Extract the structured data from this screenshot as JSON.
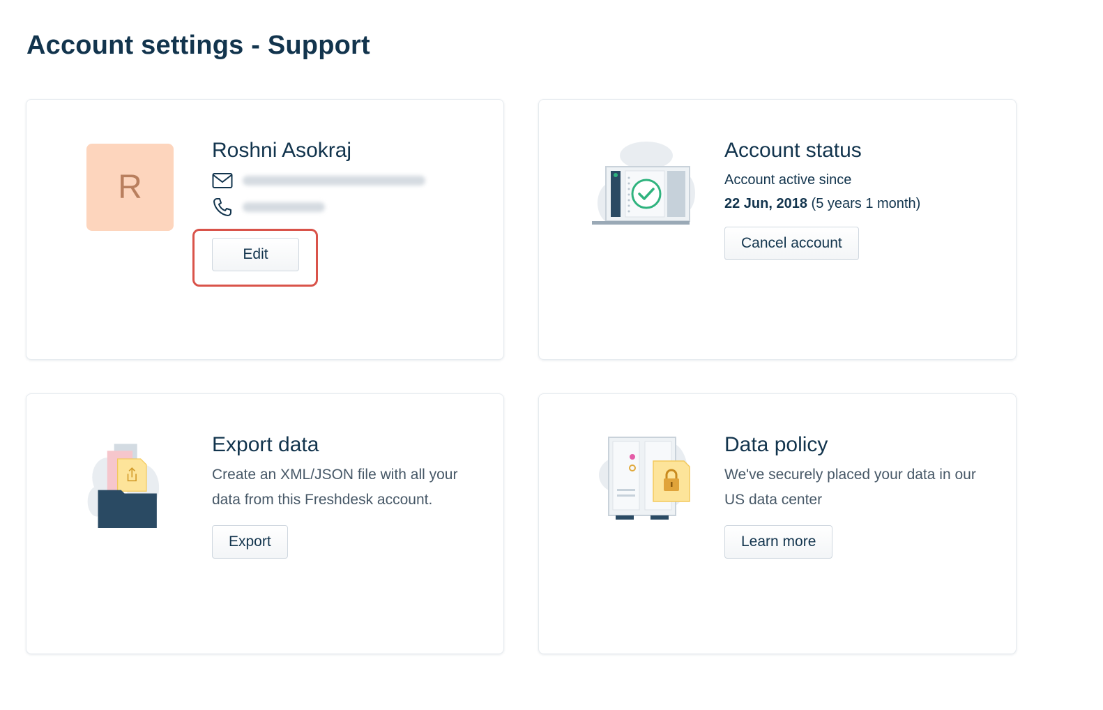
{
  "page": {
    "title": "Account settings - Support"
  },
  "profile": {
    "avatar_initial": "R",
    "name": "Roshni Asokraj",
    "edit_label": "Edit",
    "email_icon": "mail-icon",
    "phone_icon": "phone-icon"
  },
  "status": {
    "title": "Account status",
    "active_since_label": "Account active since",
    "date": "22 Jun, 2018",
    "duration": "(5 years 1 month)",
    "cancel_label": "Cancel account"
  },
  "export": {
    "title": "Export data",
    "description_line1": "Create an XML/JSON file with all your",
    "description_line2": "data from this Freshdesk account.",
    "button_label": "Export"
  },
  "policy": {
    "title": "Data policy",
    "description_line1": "We've securely placed your data in our",
    "description_line2": "US data center",
    "button_label": "Learn more"
  },
  "colors": {
    "heading": "#12344d",
    "body_text": "#475867",
    "avatar_bg": "#fdd5bd",
    "highlight": "#d9534a",
    "check_green": "#2fb37e"
  }
}
